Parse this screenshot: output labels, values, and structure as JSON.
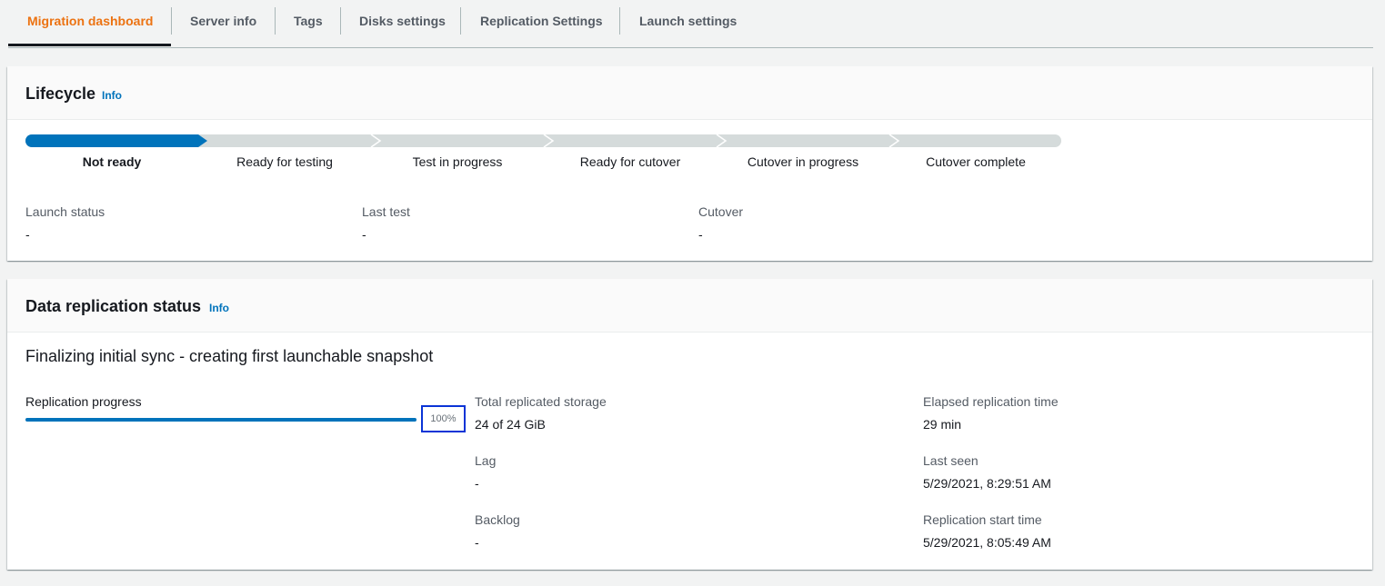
{
  "tabs": [
    {
      "label": "Migration dashboard",
      "active": true
    },
    {
      "label": "Server info"
    },
    {
      "label": "Tags"
    },
    {
      "label": "Disks settings"
    },
    {
      "label": "Replication Settings"
    },
    {
      "label": "Launch settings"
    }
  ],
  "lifecycle": {
    "title": "Lifecycle",
    "info": "Info",
    "stages": [
      "Not ready",
      "Ready for testing",
      "Test in progress",
      "Ready for cutover",
      "Cutover in progress",
      "Cutover complete"
    ],
    "current_stage": 0,
    "fields": [
      {
        "label": "Launch status",
        "value": "-"
      },
      {
        "label": "Last test",
        "value": "-"
      },
      {
        "label": "Cutover",
        "value": "-"
      }
    ]
  },
  "replication": {
    "title": "Data replication status",
    "info": "Info",
    "status_text": "Finalizing initial sync - creating first launchable snapshot",
    "progress_label": "Replication progress",
    "progress_percent": 100,
    "progress_text": "100%",
    "total_storage_label": "Total replicated storage",
    "total_storage_value": "24 of 24 GiB",
    "lag_label": "Lag",
    "lag_value": "-",
    "backlog_label": "Backlog",
    "backlog_value": "-",
    "elapsed_label": "Elapsed replication time",
    "elapsed_value": "29 min",
    "last_seen_label": "Last seen",
    "last_seen_value": "5/29/2021, 8:29:51 AM",
    "start_time_label": "Replication start time",
    "start_time_value": "5/29/2021, 8:05:49 AM"
  },
  "colors": {
    "accent_active_tab": "#ec7211",
    "link": "#0073bb",
    "progress": "#0073bb",
    "stage_inactive": "#d5dbdb",
    "highlight_box": "#0a34d6"
  }
}
